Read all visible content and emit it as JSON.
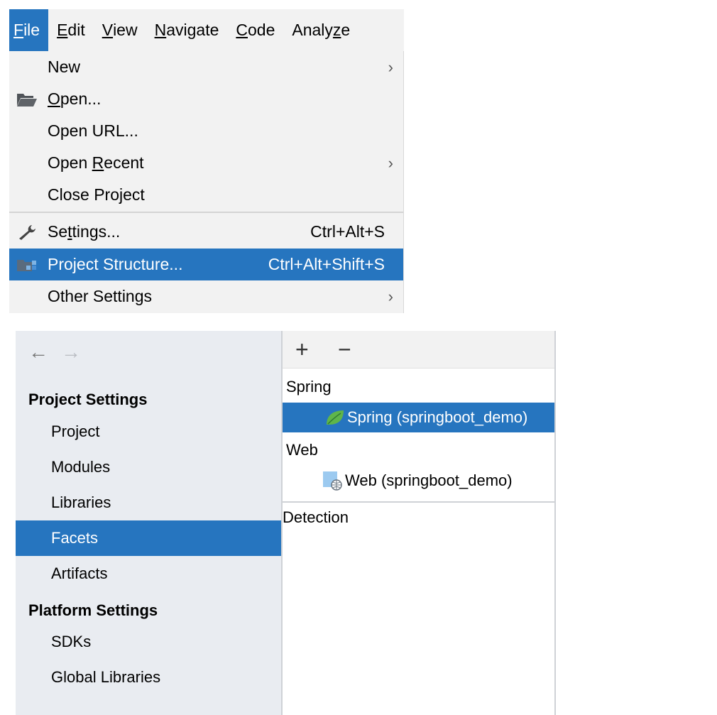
{
  "menubar": {
    "items": [
      {
        "key": "F",
        "rest": "ile"
      },
      {
        "key": "E",
        "rest": "dit"
      },
      {
        "key": "V",
        "rest": "iew"
      },
      {
        "key": "N",
        "rest": "avigate"
      },
      {
        "key": "C",
        "rest": "ode"
      },
      {
        "pre": "Analy",
        "key": "z",
        "rest": "e"
      }
    ]
  },
  "file_menu": {
    "new": "New",
    "open_key": "O",
    "open_rest": "pen...",
    "open_url": "Open URL...",
    "open_recent_pre": "Open ",
    "open_recent_key": "R",
    "open_recent_rest": "ecent",
    "close_project": "Close Project",
    "settings_pre": "Se",
    "settings_key": "t",
    "settings_rest": "tings...",
    "settings_shortcut": "Ctrl+Alt+S",
    "project_structure": "Project Structure...",
    "project_structure_shortcut": "Ctrl+Alt+Shift+S",
    "other_settings": "Other Settings",
    "submenu_arrow": "›"
  },
  "dialog": {
    "back_arrow": "←",
    "forward_arrow": "→",
    "project_settings_heading": "Project Settings",
    "project_settings_items": [
      "Project",
      "Modules",
      "Libraries",
      "Facets",
      "Artifacts"
    ],
    "selected_item": "Facets",
    "platform_settings_heading": "Platform Settings",
    "platform_settings_items": [
      "SDKs",
      "Global Libraries"
    ],
    "add_button": "+",
    "remove_button": "−",
    "facet_groups": [
      {
        "group": "Spring",
        "child": "Spring (springboot_demo)"
      },
      {
        "group": "Web",
        "child": "Web (springboot_demo)"
      }
    ],
    "detection_label": "Detection"
  },
  "colors": {
    "selection": "#2675bf",
    "menu_bg": "#f2f2f2",
    "sidebar_bg": "#e9ecf1"
  }
}
